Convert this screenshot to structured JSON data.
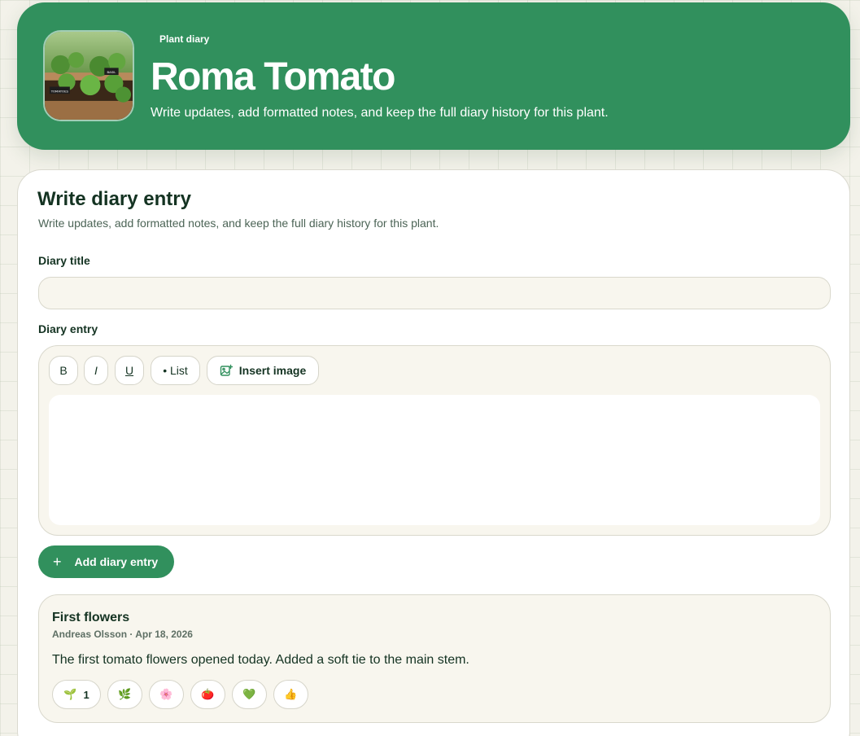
{
  "header": {
    "eyebrow": "Plant diary",
    "title": "Roma Tomato",
    "subtitle": "Write updates, add formatted notes, and keep the full diary history for this plant.",
    "image_labels": [
      "BASIL",
      "TOMATOES"
    ]
  },
  "form": {
    "heading": "Write diary entry",
    "description": "Write updates, add formatted notes, and keep the full diary history for this plant.",
    "title_label": "Diary title",
    "title_value": "",
    "entry_label": "Diary entry",
    "toolbar": {
      "bold": "B",
      "italic": "I",
      "underline": "U",
      "list": "• List",
      "insert_image": "Insert image"
    },
    "add_button": "Add diary entry"
  },
  "entries": [
    {
      "title": "First flowers",
      "meta": "Andreas Olsson · Apr 18, 2026",
      "body": "The first tomato flowers opened today. Added a soft tie to the main stem.",
      "reactions": [
        {
          "emoji": "🌱",
          "count": "1"
        },
        {
          "emoji": "🌿",
          "count": ""
        },
        {
          "emoji": "🌸",
          "count": ""
        },
        {
          "emoji": "🍅",
          "count": ""
        },
        {
          "emoji": "💚",
          "count": ""
        },
        {
          "emoji": "👍",
          "count": ""
        }
      ]
    }
  ],
  "colors": {
    "brand_green": "#31905d",
    "text_dark": "#143322",
    "panel_bg": "#f8f6ee"
  }
}
